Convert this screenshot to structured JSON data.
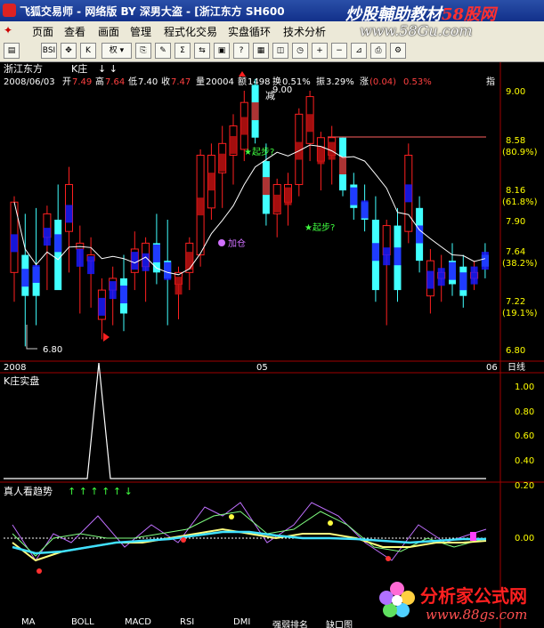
{
  "window": {
    "title": "飞狐交易师 - 网络版 BY 深男大盗 - [浙江东方 SH600",
    "watermark_left": "炒股輔助教材",
    "watermark_right": "58股网",
    "watermark_url": "www.58Gu.com"
  },
  "menu": {
    "items": [
      "页面",
      "查看",
      "画面",
      "管理",
      "程式化交易",
      "实盘循环",
      "技术分析"
    ]
  },
  "toolbar": {
    "buttons": [
      "open",
      "BSI",
      "move",
      "K",
      "数据",
      "权",
      "拷贝",
      "画线",
      "统计",
      "比较",
      "全屏",
      "帮助",
      "窗口",
      "叠加",
      "周期",
      "放大",
      "缩小",
      "测量",
      "打印"
    ],
    "weight_label": "权"
  },
  "main_panel": {
    "stock_name": "浙江东方",
    "indicator_name": "K庄",
    "arrows": "↓ ↓",
    "info": {
      "date": "2008/06/03",
      "open_label": "开",
      "open": "7.49",
      "high_label": "高",
      "high": "7.64",
      "low_label": "低",
      "low": "7.40",
      "close_label": "收",
      "close": "7.47",
      "volume_label": "量",
      "volume": "20004",
      "amount_label": "额",
      "amount": "1498",
      "turnover_label": "换",
      "turnover": "0.51%",
      "amplitude_label": "振",
      "amplitude": "3.29%",
      "change_label": "涨",
      "change": "(0.04)",
      "change_pct": "0.53%",
      "tail": "指"
    },
    "y_labels": [
      "9.00",
      "8.58",
      "(80.9%)",
      "8.16",
      "(61.8%)",
      "7.90",
      "7.64",
      "(38.2%)",
      "7.22",
      "(19.1%)",
      "6.80"
    ],
    "annotations": {
      "reduce": "减",
      "start1": "★起步?",
      "start2": "★起步?",
      "add": "加仓",
      "low_mark": "6.80",
      "high_mark": "9.00"
    },
    "x_labels": [
      "2008",
      "05",
      "06"
    ],
    "period_label": "日线"
  },
  "panel2": {
    "title": "K庄实盘",
    "y_labels": [
      "1.00",
      "0.80",
      "0.60",
      "0.40",
      "0.20"
    ]
  },
  "panel3": {
    "title": "真人看趋势",
    "arrows": "↑ ↑ ↑ ↑ ↑ ↓",
    "y_label": "0.00"
  },
  "bottom_tabs": [
    "MA",
    "BOLL",
    "MACD",
    "RSI",
    "DMI",
    "强弱排名",
    "缺口图"
  ],
  "bottom_watermark": {
    "name": "分析家公式网",
    "url": "www.88gs.com"
  },
  "colors": {
    "background": "#000000",
    "up_candle": "#ff2020",
    "down_candle": "#40ffff",
    "blue_ma": "#1a1aff",
    "ma_line": "#ffffff",
    "axis": "#a00000"
  },
  "candles": [
    {
      "o": 7.45,
      "h": 8.1,
      "l": 7.2,
      "c": 8.05
    },
    {
      "o": 7.6,
      "h": 7.95,
      "l": 6.82,
      "c": 7.25
    },
    {
      "o": 7.5,
      "h": 8.0,
      "l": 7.0,
      "c": 7.25
    },
    {
      "o": 7.75,
      "h": 8.02,
      "l": 7.3,
      "c": 7.95
    },
    {
      "o": 7.9,
      "h": 8.2,
      "l": 7.4,
      "c": 7.3
    },
    {
      "o": 7.8,
      "h": 8.35,
      "l": 7.45,
      "c": 8.2
    },
    {
      "o": 7.65,
      "h": 7.85,
      "l": 7.1,
      "c": 7.7
    },
    {
      "o": 7.55,
      "h": 7.75,
      "l": 7.15,
      "c": 7.6
    },
    {
      "o": 7.05,
      "h": 7.4,
      "l": 6.88,
      "c": 7.3
    },
    {
      "o": 7.3,
      "h": 7.5,
      "l": 7.0,
      "c": 7.4
    },
    {
      "o": 7.4,
      "h": 7.6,
      "l": 6.95,
      "c": 7.1
    },
    {
      "o": 7.45,
      "h": 7.8,
      "l": 7.3,
      "c": 7.65
    },
    {
      "o": 7.5,
      "h": 7.75,
      "l": 7.2,
      "c": 7.7
    },
    {
      "o": 7.7,
      "h": 7.95,
      "l": 7.35,
      "c": 7.45
    },
    {
      "o": 7.55,
      "h": 7.9,
      "l": 7.0,
      "c": 7.4
    },
    {
      "o": 7.35,
      "h": 7.5,
      "l": 7.05,
      "c": 7.45
    },
    {
      "o": 7.45,
      "h": 7.75,
      "l": 7.3,
      "c": 7.7
    },
    {
      "o": 7.6,
      "h": 8.5,
      "l": 7.5,
      "c": 8.45
    },
    {
      "o": 8.0,
      "h": 8.55,
      "l": 7.9,
      "c": 8.45
    },
    {
      "o": 8.3,
      "h": 8.7,
      "l": 8.0,
      "c": 8.55
    },
    {
      "o": 8.45,
      "h": 8.8,
      "l": 8.2,
      "c": 8.7
    },
    {
      "o": 8.5,
      "h": 9.0,
      "l": 8.4,
      "c": 8.9
    },
    {
      "o": 9.05,
      "h": 9.1,
      "l": 8.55,
      "c": 8.6
    },
    {
      "o": 8.4,
      "h": 8.55,
      "l": 7.85,
      "c": 7.95
    },
    {
      "o": 7.95,
      "h": 8.25,
      "l": 7.75,
      "c": 8.2
    },
    {
      "o": 8.05,
      "h": 8.3,
      "l": 7.85,
      "c": 8.2
    },
    {
      "o": 8.2,
      "h": 8.85,
      "l": 8.1,
      "c": 8.8
    },
    {
      "o": 8.55,
      "h": 9.0,
      "l": 8.4,
      "c": 8.95
    },
    {
      "o": 8.4,
      "h": 8.65,
      "l": 8.15,
      "c": 8.6
    },
    {
      "o": 8.45,
      "h": 8.7,
      "l": 8.2,
      "c": 8.6
    },
    {
      "o": 8.6,
      "h": 8.6,
      "l": 8.1,
      "c": 8.15
    },
    {
      "o": 8.2,
      "h": 8.3,
      "l": 7.9,
      "c": 8.0
    },
    {
      "o": 8.05,
      "h": 8.2,
      "l": 7.8,
      "c": 7.9
    },
    {
      "o": 7.9,
      "h": 8.1,
      "l": 7.2,
      "c": 7.3
    },
    {
      "o": 7.6,
      "h": 7.9,
      "l": 7.0,
      "c": 7.85
    },
    {
      "o": 7.85,
      "h": 8.0,
      "l": 7.2,
      "c": 7.3
    },
    {
      "o": 7.8,
      "h": 8.55,
      "l": 7.7,
      "c": 8.45
    },
    {
      "o": 8.0,
      "h": 8.1,
      "l": 7.45,
      "c": 7.55
    },
    {
      "o": 7.25,
      "h": 7.65,
      "l": 7.1,
      "c": 7.55
    },
    {
      "o": 7.4,
      "h": 7.6,
      "l": 7.2,
      "c": 7.45
    },
    {
      "o": 7.55,
      "h": 7.7,
      "l": 7.25,
      "c": 7.35
    },
    {
      "o": 7.5,
      "h": 7.6,
      "l": 7.15,
      "c": 7.25
    },
    {
      "o": 7.4,
      "h": 7.55,
      "l": 7.3,
      "c": 7.45
    },
    {
      "o": 7.6,
      "h": 7.7,
      "l": 7.4,
      "c": 7.5
    }
  ]
}
